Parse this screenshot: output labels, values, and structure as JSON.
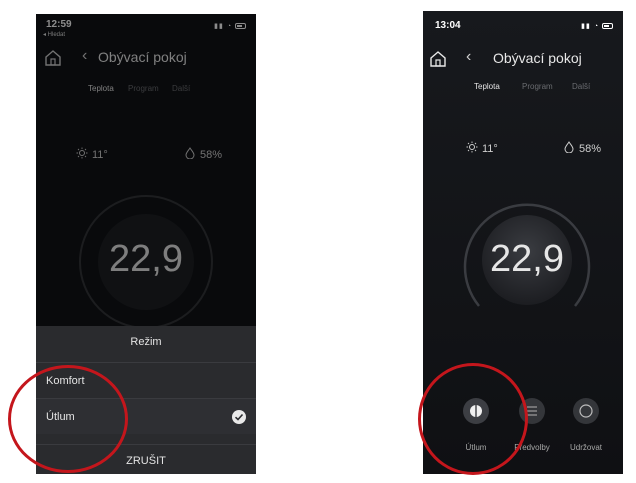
{
  "left": {
    "clock": "12:59",
    "back_app": "◂ Hledat",
    "title": "Obývací pokoj",
    "tabs": [
      "Teplota",
      "Program",
      "Další"
    ],
    "outdoor_temp": "11°",
    "humidity": "58%",
    "temperature": "22,9",
    "sheet": {
      "title": "Režim",
      "options": [
        "Komfort",
        "Útlum"
      ],
      "selected": "Útlum",
      "cancel": "ZRUŠIT"
    }
  },
  "right": {
    "clock": "13:04",
    "title": "Obývací pokoj",
    "tabs": [
      "Teplota",
      "Program",
      "Další"
    ],
    "outdoor_temp": "11°",
    "humidity": "58%",
    "temperature": "22,9",
    "modes": [
      {
        "label": "Útlum",
        "icon": "half-moon-icon",
        "active": true
      },
      {
        "label": "Předvolby",
        "icon": "list-icon",
        "active": false
      },
      {
        "label": "Udržovat",
        "icon": "ring-icon",
        "active": false
      }
    ]
  },
  "colors": {
    "annotation": "#c4161c",
    "background": "#111317",
    "sheet": "#2a2b2e"
  }
}
